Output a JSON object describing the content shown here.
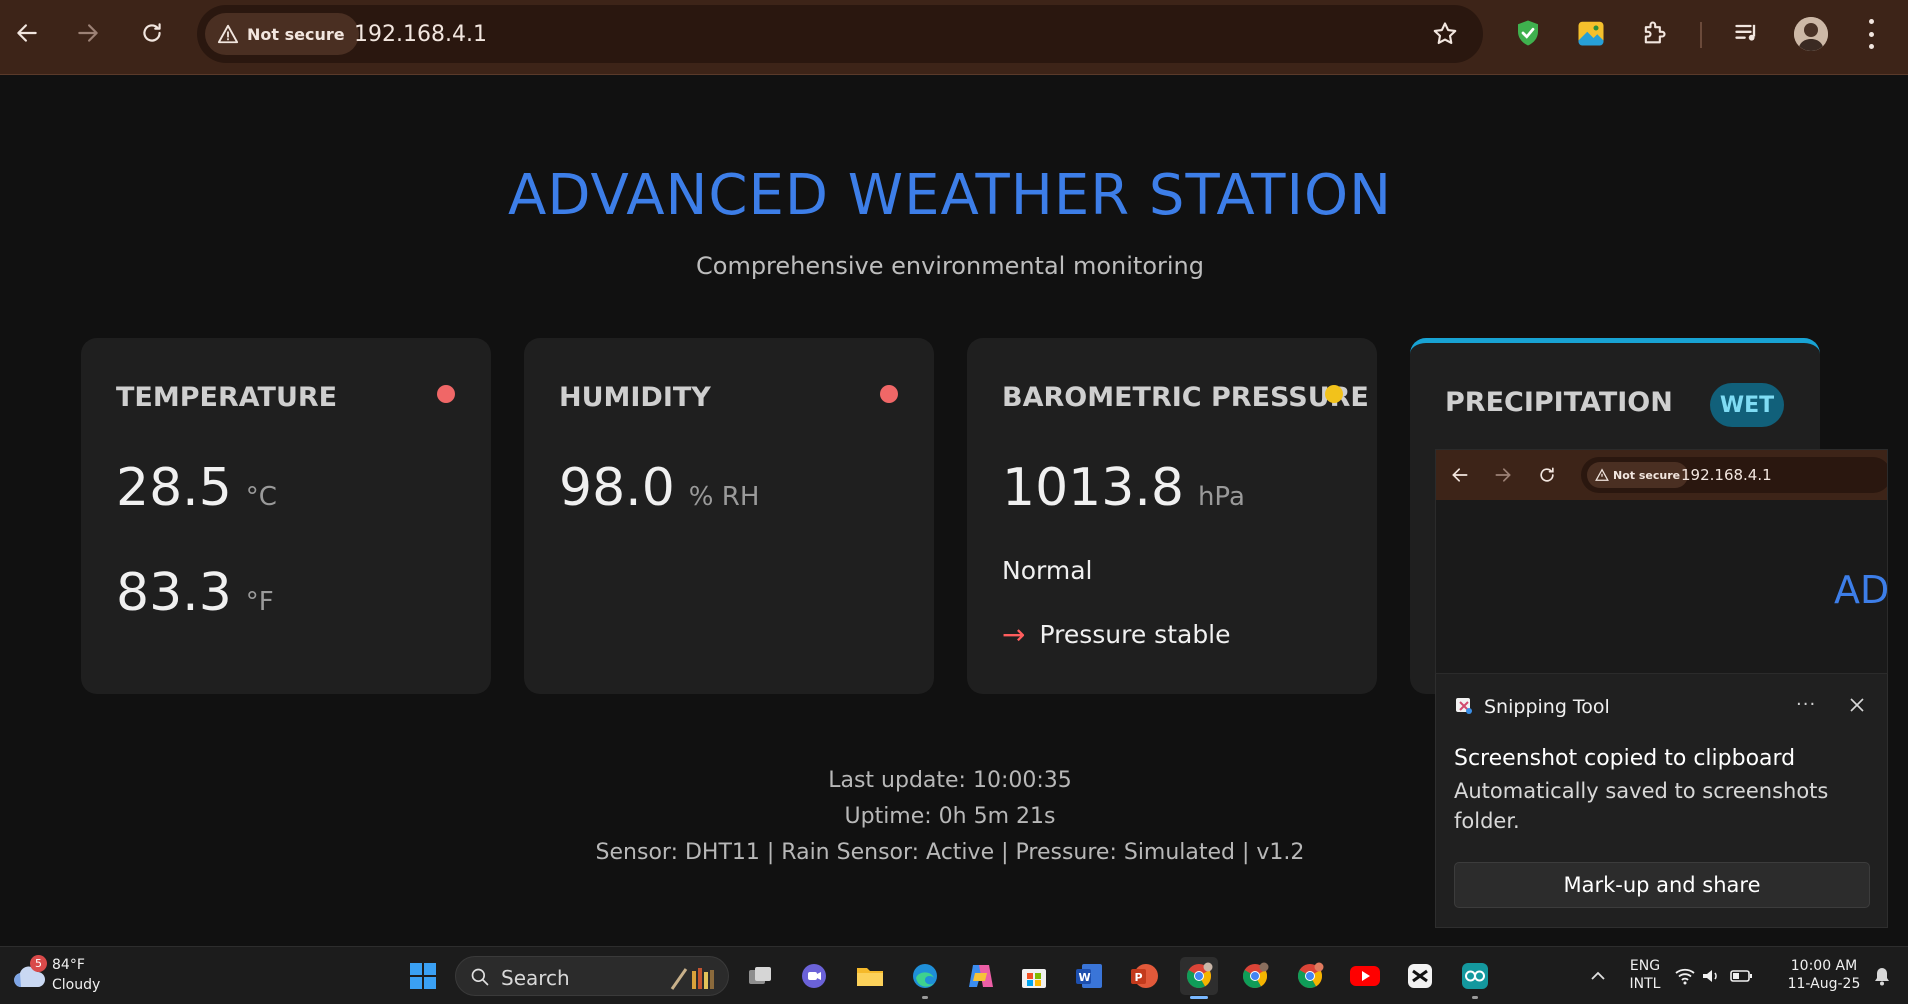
{
  "browser": {
    "security_label": "Not secure",
    "url": "192.168.4.1",
    "icons": [
      "back-arrow-icon",
      "forward-arrow-icon",
      "reload-icon",
      "warning-icon",
      "star-icon",
      "shield-extension-icon",
      "image-extension-icon",
      "puzzle-extensions-icon",
      "media-queue-icon",
      "profile-avatar",
      "more-menu-icon"
    ]
  },
  "page": {
    "title": "ADVANCED WEATHER STATION",
    "subtitle": "Comprehensive environmental monitoring"
  },
  "cards": {
    "temperature": {
      "title": "TEMPERATURE",
      "celsius": "28.5",
      "celsius_unit": "°C",
      "fahrenheit": "83.3",
      "fahrenheit_unit": "°F",
      "status_color": "#f06767"
    },
    "humidity": {
      "title": "HUMIDITY",
      "value": "98.0",
      "unit": "% RH",
      "status_color": "#f06767"
    },
    "pressure": {
      "title": "BAROMETRIC PRESSURE",
      "value": "1013.8",
      "unit": "hPa",
      "status": "Normal",
      "trend_arrow": "→",
      "trend": "Pressure stable",
      "status_color": "#f2c21b"
    },
    "precipitation": {
      "title": "PRECIPITATION",
      "badge": "WET",
      "accent": "#18a3d4"
    }
  },
  "footer": {
    "last_update": "Last update: 10:00:35",
    "uptime": "Uptime: 0h 5m 21s",
    "sensors": "Sensor: DHT11 | Rain Sensor: Active | Pressure: Simulated | v1.2"
  },
  "snip_preview": {
    "security_label": "Not secure",
    "url": "192.168.4.1",
    "title_fragment": "AD"
  },
  "toast": {
    "app": "Snipping Tool",
    "more": "···",
    "heading": "Screenshot copied to clipboard",
    "body": "Automatically saved to screenshots folder.",
    "button": "Mark-up and share"
  },
  "taskbar": {
    "weather_badge": "5",
    "weather_temp": "84°F",
    "weather_condition": "Cloudy",
    "search_label": "Search",
    "language_line1": "ENG",
    "language_line2": "INTL",
    "time": "10:00 AM",
    "date": "11-Aug-25"
  },
  "colors": {
    "accent_blue": "#3d7ee8",
    "browser_chrome": "#3d2418",
    "card_bg": "#1f1f1f",
    "page_bg": "#111111"
  }
}
